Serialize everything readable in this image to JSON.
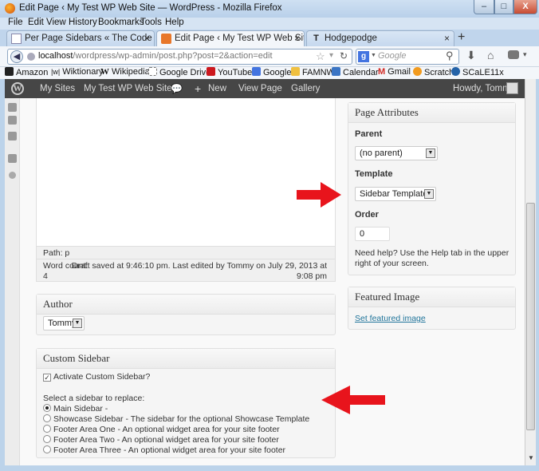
{
  "window": {
    "title": "Edit Page ‹ My Test WP Web Site — WordPress - Mozilla Firefox",
    "min": "–",
    "max": "□",
    "close": "X"
  },
  "menu": [
    "File",
    "Edit",
    "View",
    "History",
    "Bookmarks",
    "Tools",
    "Help"
  ],
  "tabs": [
    {
      "label": "Per Page Sidebars « The Code Cave",
      "close": "×"
    },
    {
      "label": "Edit Page ‹ My Test WP Web Site — ...",
      "close": "×"
    },
    {
      "label": "Hodgepodge",
      "close": "×"
    }
  ],
  "new_tab": "+",
  "url": {
    "host": "localhost",
    "path": "/wordpress/wp-admin/post.php?post=2&action=edit"
  },
  "search": {
    "placeholder": "Google",
    "engine_letter": "g"
  },
  "bookmarks": [
    "Amazon",
    "Wiktionary",
    "Wikipedia",
    "Google Drive",
    "YouTube",
    "Google",
    "FAMNW",
    "Calendar",
    "Gmail",
    "Scratch",
    "SCaLE11x"
  ],
  "bookmark_prefixes": {
    "wiktionary": "|w|",
    "wikipedia": "W",
    "gmail": "M"
  },
  "wpbar": {
    "my_sites": "My Sites",
    "site": "My Test WP Web Site",
    "comments_glyph": "💬",
    "new_plus": "+",
    "new": "New",
    "view_page": "View Page",
    "gallery": "Gallery",
    "howdy": "Howdy, Tommy"
  },
  "editor": {
    "path": "Path: p",
    "word_count_label": "Word count:",
    "word_count": "4",
    "saved": "Draft saved at 9:46:10 pm. Last edited by Tommy on July 29, 2013 at",
    "saved_time": "9:08 pm"
  },
  "author": {
    "title": "Author",
    "value": "Tommy"
  },
  "sidebar_box": {
    "title": "Custom Sidebar",
    "activate": "Activate Custom Sidebar?",
    "select_label": "Select a sidebar to replace:",
    "options": [
      "Main Sidebar -",
      "Showcase Sidebar - The sidebar for the optional Showcase Template",
      "Footer Area One - An optional widget area for your site footer",
      "Footer Area Two - An optional widget area for your site footer",
      "Footer Area Three - An optional widget area for your site footer"
    ]
  },
  "attributes": {
    "title": "Page Attributes",
    "parent_label": "Parent",
    "parent_value": "(no parent)",
    "template_label": "Template",
    "template_value": "Sidebar Template",
    "order_label": "Order",
    "order_value": "0",
    "help": "Need help? Use the Help tab in the upper right of your screen."
  },
  "featured": {
    "title": "Featured Image",
    "link": "Set featured image"
  },
  "colors": {
    "arrow": "#e8141c",
    "wpbar": "#464646",
    "link": "#21759b"
  }
}
